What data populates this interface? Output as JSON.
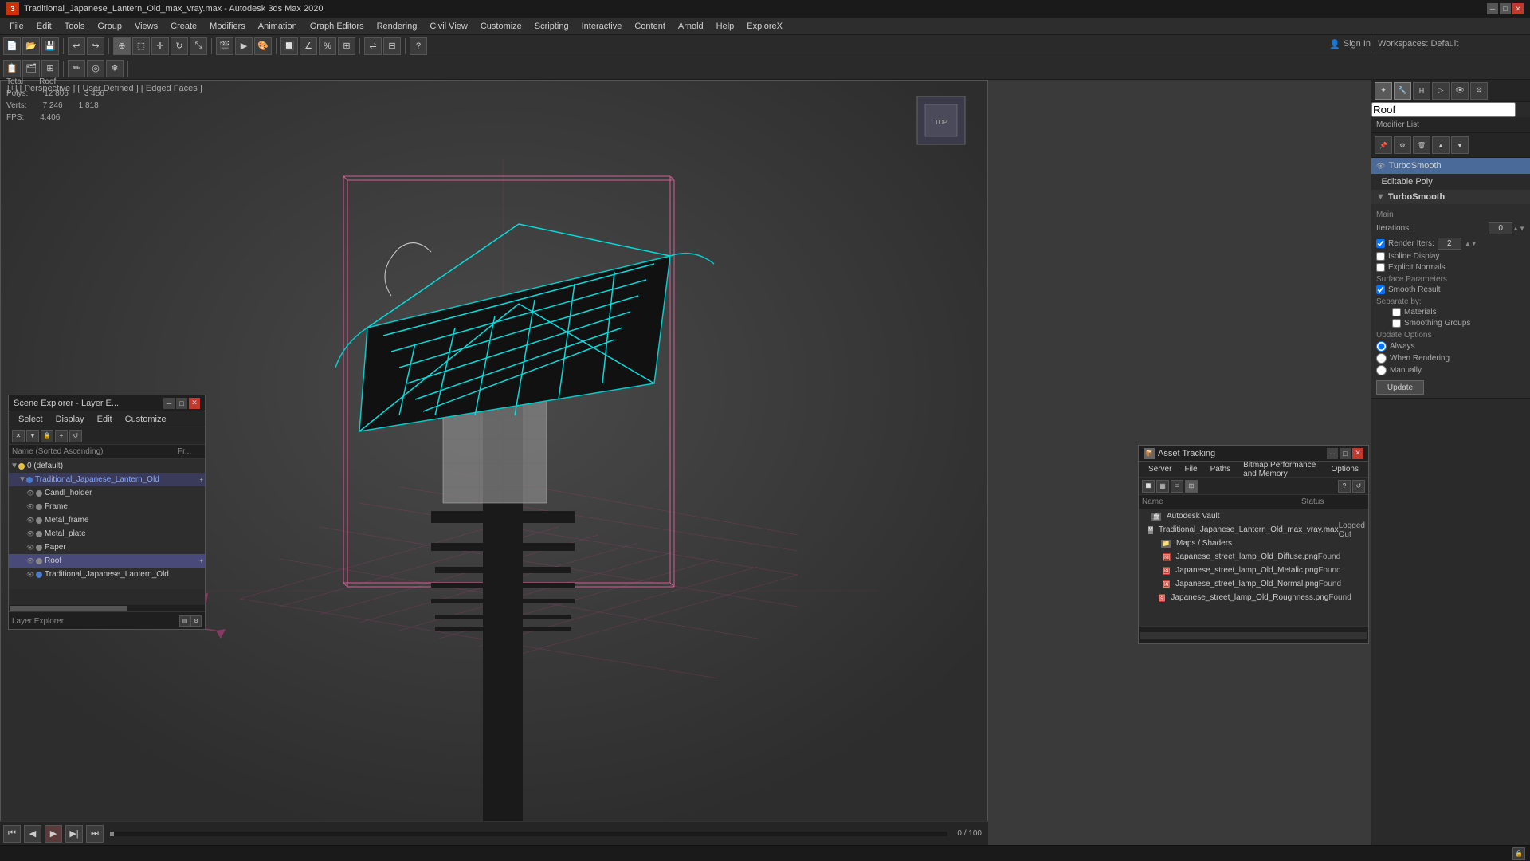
{
  "titleBar": {
    "title": "Traditional_Japanese_Lantern_Old_max_vray.max - Autodesk 3ds Max 2020",
    "icon": "3"
  },
  "menu": {
    "items": [
      "File",
      "Edit",
      "Tools",
      "Group",
      "Views",
      "Create",
      "Modifiers",
      "Animation",
      "Graph Editors",
      "Rendering",
      "Civil View",
      "Customize",
      "Scripting",
      "Interactive",
      "Content",
      "Arnold",
      "Help",
      "ExploreX"
    ]
  },
  "signin": {
    "label": "Sign In",
    "workspaces": "Workspaces:",
    "workspace": "Default"
  },
  "viewport": {
    "label": "[+] [ Perspective ] [ User Defined ] [ Edged Faces ]",
    "stats": {
      "polys_label": "Polys:",
      "polys_total": "12 806",
      "polys_roof": "3 456",
      "verts_label": "Verts:",
      "verts_total": "7 246",
      "verts_roof": "1 818",
      "fps_label": "FPS:",
      "fps_value": "4.406",
      "total_label": "Total",
      "roof_label": "Roof"
    }
  },
  "rightPanel": {
    "modifier_name": "Roof",
    "modifier_list_header": "Modifier List",
    "modifiers": [
      {
        "name": "TurboSmooth",
        "selected": true,
        "eye": true
      },
      {
        "name": "Editable Poly",
        "selected": false,
        "eye": false
      }
    ],
    "turbosmooth": {
      "title": "TurboSmooth",
      "main_label": "Main",
      "iterations_label": "Iterations:",
      "iterations_value": "0",
      "render_iters_label": "Render Iters:",
      "render_iters_value": "2",
      "isoline_display": "Isoline Display",
      "explicit_normals": "Explicit Normals",
      "surface_params": "Surface Parameters",
      "smooth_result": "Smooth Result",
      "separate_by": "Separate by:",
      "materials": "Materials",
      "smoothing_groups": "Smoothing Groups",
      "update_options": "Update Options",
      "always": "Always",
      "when_rendering": "When Rendering",
      "manually": "Manually",
      "update_btn": "Update"
    }
  },
  "sceneExplorer": {
    "title": "Scene Explorer - Layer E...",
    "menu": [
      "Select",
      "Display",
      "Edit",
      "Customize"
    ],
    "header_name": "Name (Sorted Ascending)",
    "header_fr": "Fr...",
    "items": [
      {
        "name": "0 (default)",
        "level": 0,
        "expanded": true,
        "type": "layer"
      },
      {
        "name": "Traditional_Japanese_Lantern_Old",
        "level": 1,
        "expanded": true,
        "type": "object",
        "selected": true
      },
      {
        "name": "Candl_holder",
        "level": 2,
        "expanded": false,
        "type": "mesh"
      },
      {
        "name": "Frame",
        "level": 2,
        "expanded": false,
        "type": "mesh"
      },
      {
        "name": "Metal_frame",
        "level": 2,
        "expanded": false,
        "type": "mesh"
      },
      {
        "name": "Metal_plate",
        "level": 2,
        "expanded": false,
        "type": "mesh"
      },
      {
        "name": "Paper",
        "level": 2,
        "expanded": false,
        "type": "mesh"
      },
      {
        "name": "Roof",
        "level": 2,
        "expanded": false,
        "type": "mesh",
        "highlighted": true
      },
      {
        "name": "Traditional_Japanese_Lantern_Old",
        "level": 2,
        "expanded": false,
        "type": "object"
      }
    ],
    "footer_label": "Layer Explorer",
    "scrollbar_label": ""
  },
  "assetTracking": {
    "title": "Asset Tracking",
    "menu": [
      "Server",
      "File",
      "Paths",
      "Bitmap Performance and Memory",
      "Options"
    ],
    "col_name": "Name",
    "col_status": "Status",
    "items": [
      {
        "name": "Autodesk Vault",
        "level": 0,
        "type": "folder",
        "status": ""
      },
      {
        "name": "Traditional_Japanese_Lantern_Old_max_vray.max",
        "level": 1,
        "type": "max",
        "status": "Logged Out"
      },
      {
        "name": "Maps / Shaders",
        "level": 1,
        "type": "folder",
        "status": ""
      },
      {
        "name": "Japanese_street_lamp_Old_Diffuse.png",
        "level": 2,
        "type": "image",
        "status": "Found"
      },
      {
        "name": "Japanese_street_lamp_Old_Metalic.png",
        "level": 2,
        "type": "image",
        "status": "Found"
      },
      {
        "name": "Japanese_street_lamp_Old_Normal.png",
        "level": 2,
        "type": "image",
        "status": "Found"
      },
      {
        "name": "Japanese_street_lamp_Old_Roughness.png",
        "level": 2,
        "type": "image",
        "status": "Found"
      }
    ]
  },
  "statusBar": {
    "text": ""
  }
}
